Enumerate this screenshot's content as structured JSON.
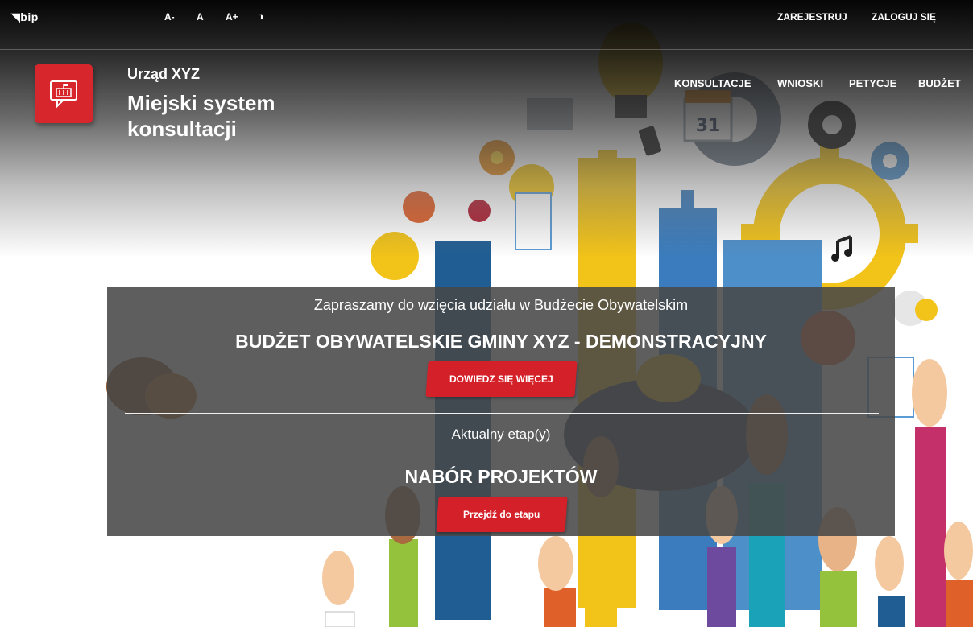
{
  "topbar": {
    "bip_label": "bip",
    "font_smaller": "A-",
    "font_normal": "A",
    "font_larger": "A+",
    "contrast_icon": "contrast-icon",
    "register": "ZAREJESTRUJ",
    "login": "ZALOGUJ SIĘ"
  },
  "header": {
    "logo_icon": "building-speech-icon",
    "org_name": "Urząd XYZ",
    "system_title": "Miejski system konsultacji"
  },
  "nav": {
    "items": [
      "KONSULTACJE",
      "WNIOSKI",
      "PETYCJE",
      "BUDŻET"
    ]
  },
  "banner": {
    "intro": "Zapraszamy do wzięcia udziału w Budżecie Obywatelskim",
    "title": "BUDŻET OBYWATELSKIE GMINY XYZ - DEMONSTRACYJNY",
    "more_button": "DOWIEDZ SIĘ WIĘCEJ",
    "stage_label": "Aktualny etap(y)",
    "stage_name": "NABÓR PROJEKTÓW",
    "stage_button": "Przejdź do etapu"
  },
  "illustration": {
    "calendar_day": "31"
  },
  "colors": {
    "brand_red": "#d42129",
    "panel_bg": "#484848",
    "topbar_bg": "#000000"
  }
}
